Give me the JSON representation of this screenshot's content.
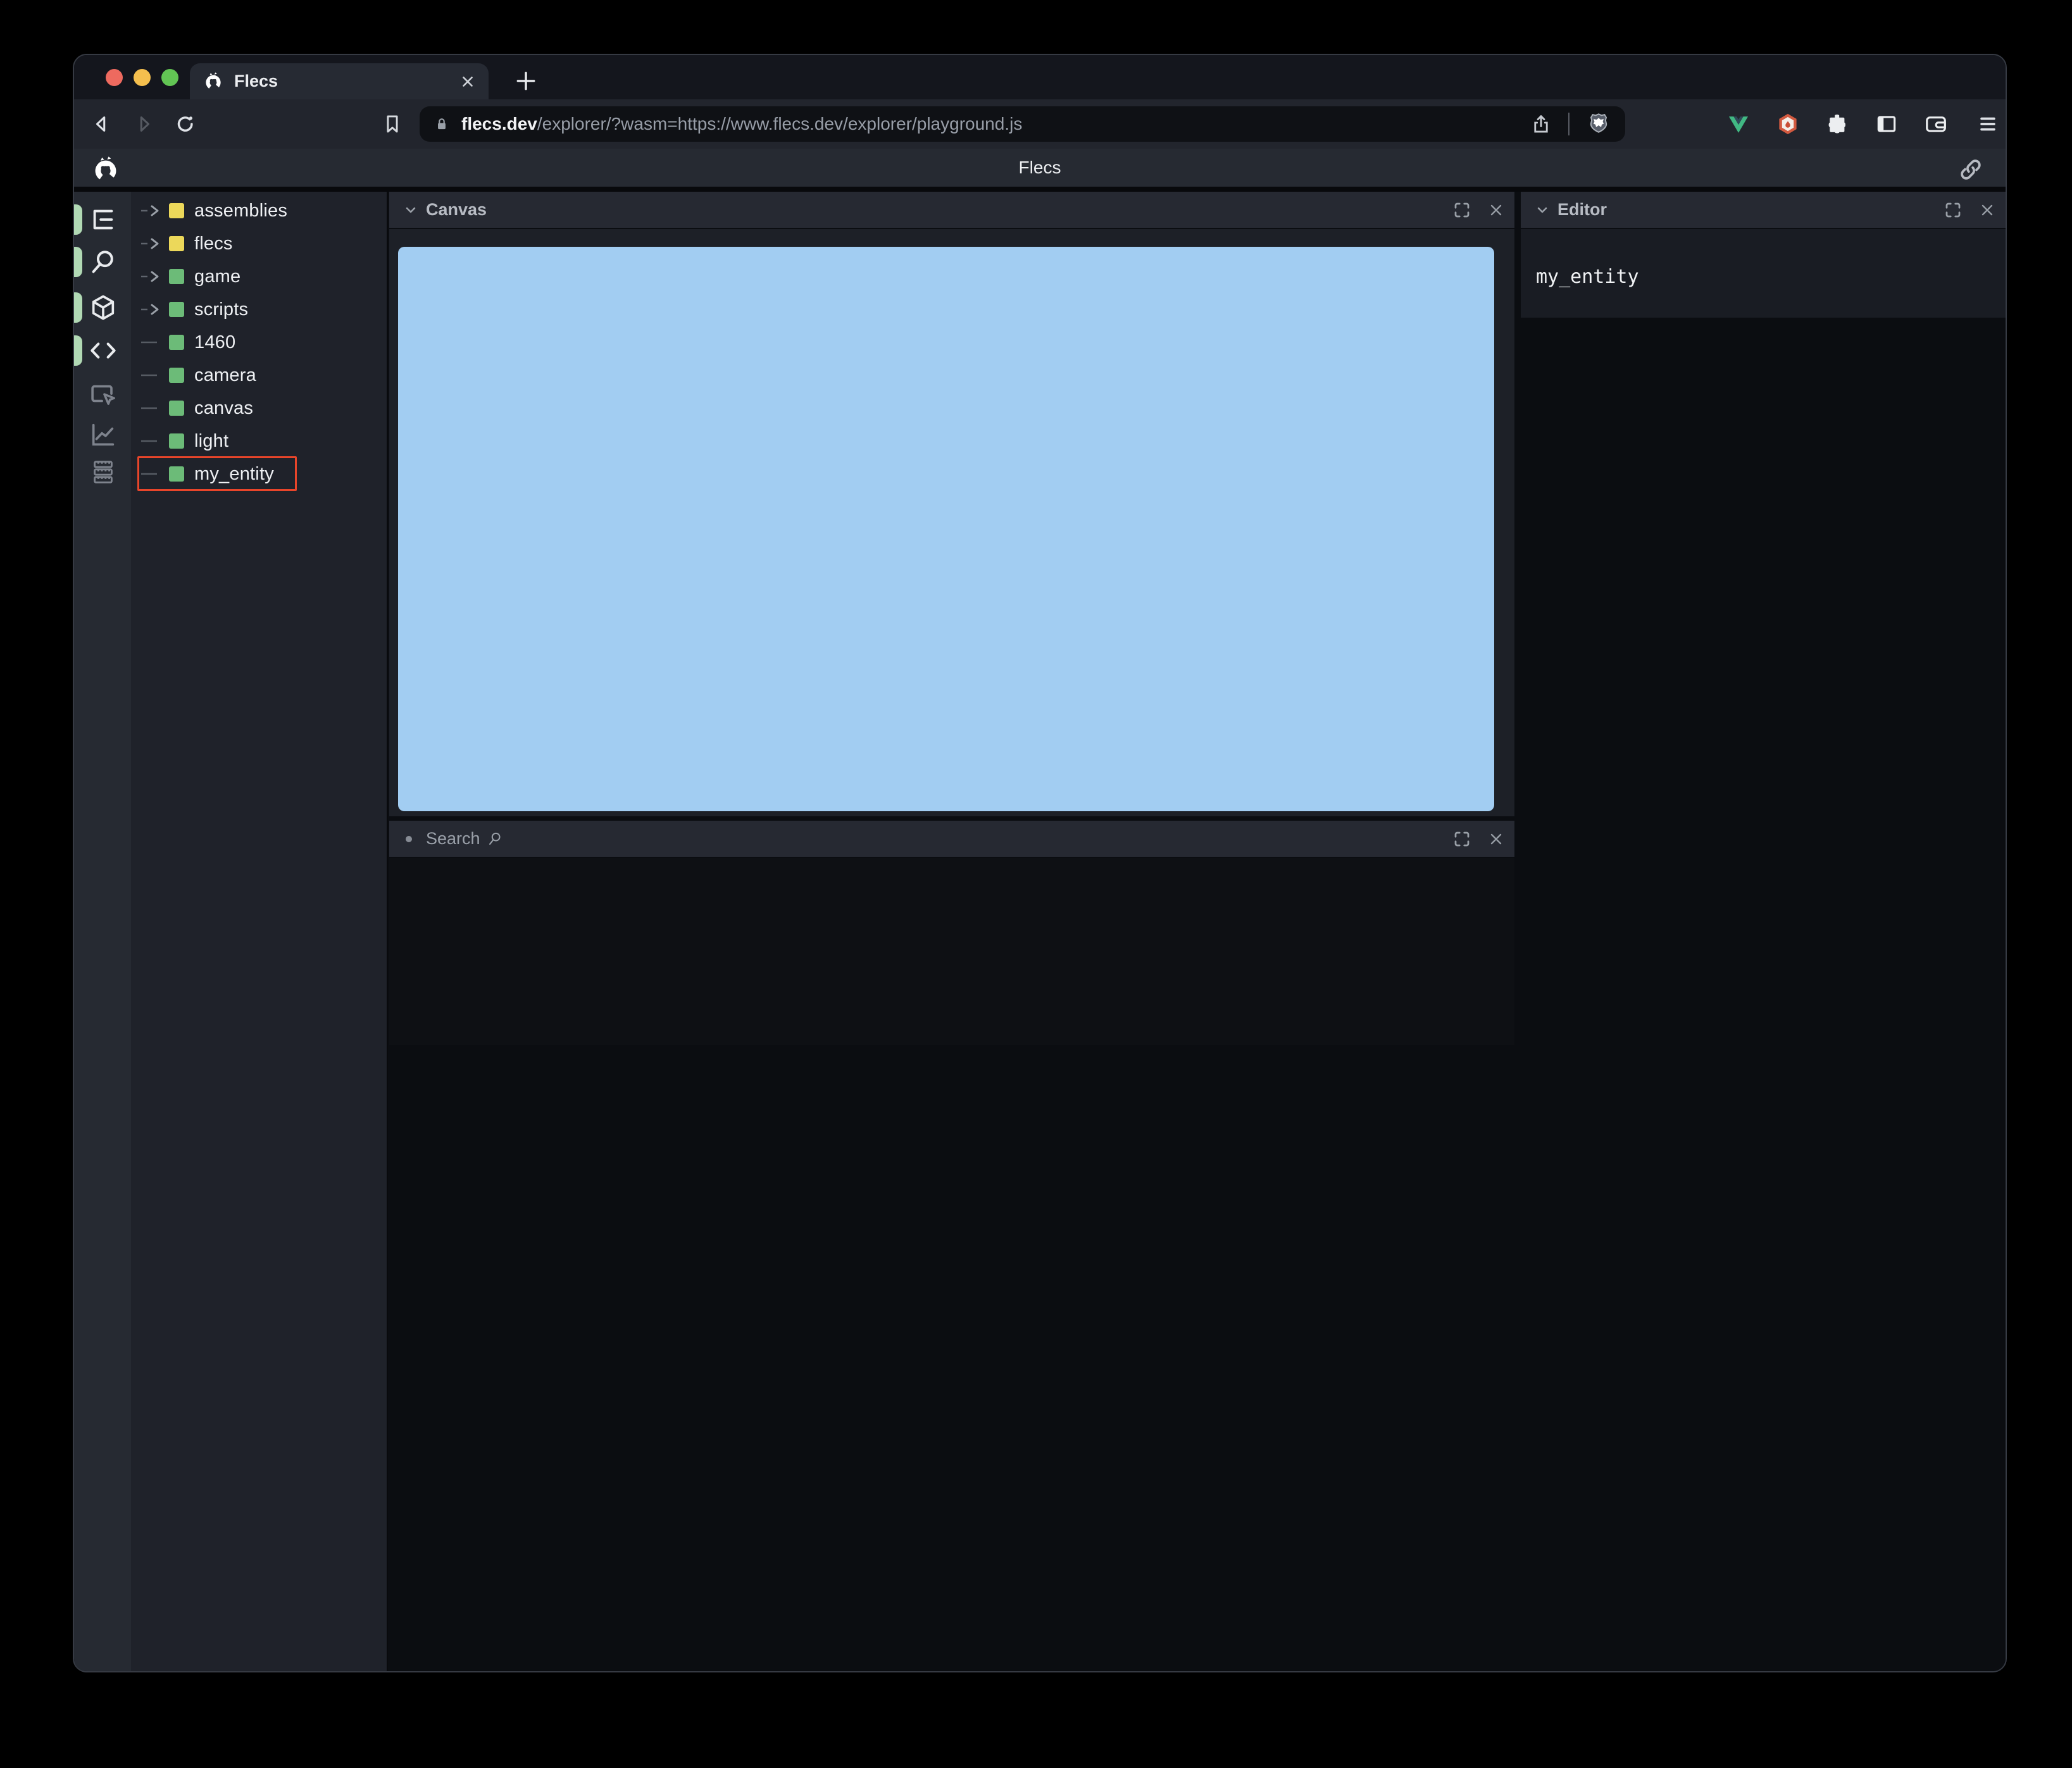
{
  "browser": {
    "tab": {
      "title": "Flecs"
    },
    "address": {
      "domain": "flecs.dev",
      "path": "/explorer/?wasm=https://www.flecs.dev/explorer/playground.js"
    }
  },
  "app": {
    "header": {
      "title": "Flecs"
    },
    "sidebar": [
      {
        "name": "tree",
        "active": true
      },
      {
        "name": "search",
        "active": true
      },
      {
        "name": "entities",
        "active": true
      },
      {
        "name": "code",
        "active": true
      },
      {
        "name": "inspector",
        "active": false
      },
      {
        "name": "stats",
        "active": false
      },
      {
        "name": "commands",
        "active": false
      }
    ],
    "tree": {
      "items": [
        {
          "label": "assemblies",
          "color": "yellow",
          "expandable": true,
          "highlighted": false
        },
        {
          "label": "flecs",
          "color": "yellow",
          "expandable": true,
          "highlighted": false
        },
        {
          "label": "game",
          "color": "green",
          "expandable": true,
          "highlighted": false
        },
        {
          "label": "scripts",
          "color": "green",
          "expandable": true,
          "highlighted": false
        },
        {
          "label": "1460",
          "color": "green",
          "expandable": false,
          "highlighted": false
        },
        {
          "label": "camera",
          "color": "green",
          "expandable": false,
          "highlighted": false
        },
        {
          "label": "canvas",
          "color": "green",
          "expandable": false,
          "highlighted": false
        },
        {
          "label": "light",
          "color": "green",
          "expandable": false,
          "highlighted": false
        },
        {
          "label": "my_entity",
          "color": "green",
          "expandable": false,
          "highlighted": true
        }
      ]
    },
    "panels": {
      "canvas": {
        "title": "Canvas"
      },
      "search": {
        "title": "Search"
      },
      "editor": {
        "title": "Editor",
        "content": "my_entity"
      }
    }
  },
  "colors": {
    "canvas_blue": "#a2cdf2",
    "tree_yellow": "#ecd85a",
    "tree_green": "#6cbb78",
    "active_indicator_green": "#b1d9b4",
    "highlight_red": "#e8452a"
  }
}
